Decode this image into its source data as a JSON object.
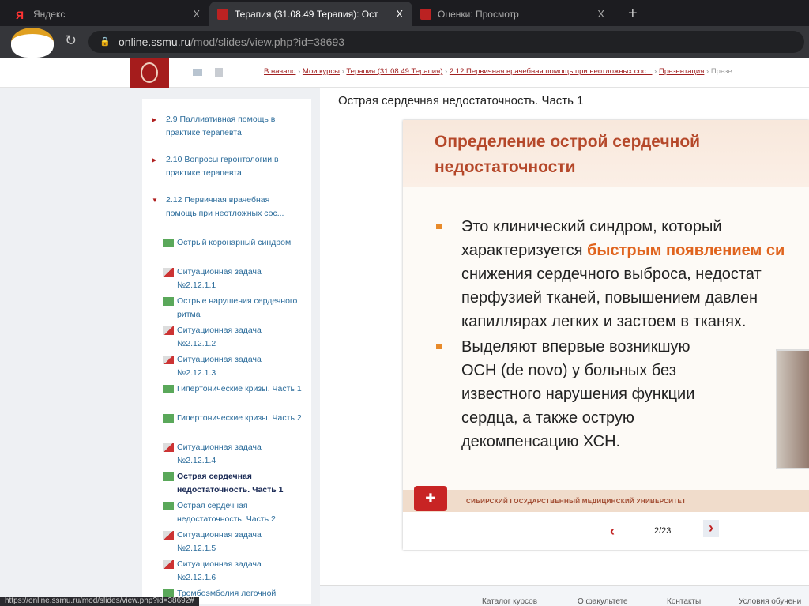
{
  "tabs": [
    {
      "label": "Яндекс",
      "close": "X"
    },
    {
      "label": "Терапия (31.08.49 Терапия): Ост",
      "close": "X"
    },
    {
      "label": "Оценки: Просмотр",
      "close": "X"
    }
  ],
  "new_tab": "+",
  "address": {
    "host": "online.ssmu.ru",
    "path": "/mod/slides/view.php?id=38693"
  },
  "breadcrumbs": [
    "В начало",
    "Мои курсы",
    "Терапия (31.08.49 Терапия)",
    "2.12 Первичная врачебная помощь при неотложных сос...",
    "Презентация",
    "Презе"
  ],
  "sidebar": [
    {
      "label": "2.9 Паллиативная помощь в практике терапевта",
      "type": "section"
    },
    {
      "label": "2.10 Вопросы геронтологии в практике терапевта",
      "type": "section"
    },
    {
      "label": "2.12 Первичная врачебная помощь при неотложных сос...",
      "type": "section-open"
    },
    {
      "label": "Острый коронарный синдром",
      "type": "slides"
    },
    {
      "label": "Ситуационная задача №2.12.1.1",
      "type": "quiz"
    },
    {
      "label": "Острые нарушения сердечного ритма",
      "type": "slides"
    },
    {
      "label": "Ситуационная задача №2.12.1.2",
      "type": "quiz"
    },
    {
      "label": "Ситуационная задача №2.12.1.3",
      "type": "quiz"
    },
    {
      "label": "Гипертонические кризы. Часть 1",
      "type": "slides"
    },
    {
      "label": "Гипертонические кризы. Часть 2",
      "type": "slides"
    },
    {
      "label": "Ситуационная задача №2.12.1.4",
      "type": "quiz"
    },
    {
      "label": "Острая сердечная недостаточность. Часть 1",
      "type": "slides-current"
    },
    {
      "label": "Острая сердечная недостаточность. Часть 2",
      "type": "slides"
    },
    {
      "label": "Ситуационная задача №2.12.1.5",
      "type": "quiz"
    },
    {
      "label": "Ситуационная задача №2.12.1.6",
      "type": "quiz"
    },
    {
      "label": "Тромбоэмболия легочной",
      "type": "slides"
    }
  ],
  "page_title": "Острая сердечная недостаточность. Часть 1",
  "slide": {
    "heading1": "Определение острой сердечной",
    "heading2": "недостаточности",
    "b1_l1": "Это клинический синдром, который",
    "b1_l2a": "характеризуется ",
    "b1_l2b": "быстрым появлением си",
    "b1_l3": "снижения сердечного выброса, недостат",
    "b1_l4": "перфузией тканей, повышением давлен",
    "b1_l5": "капиллярах легких и застоем в тканях.",
    "b2": [
      "Выделяют впервые возникшую",
      "ОСН (de novo) у больных без",
      "известного нарушения функции",
      "сердца, а также острую",
      "декомпенсацию ХСН."
    ],
    "footer": "СИБИРСКИЙ ГОСУДАРСТВЕННЫЙ МЕДИЦИНСКИЙ УНИВЕРСИТЕТ"
  },
  "pager": {
    "prev": "‹",
    "next": "›",
    "counter": "2/23"
  },
  "footer_links": [
    "Каталог курсов",
    "О факультете",
    "Контакты",
    "Условия обучени"
  ],
  "status_url": "https://online.ssmu.ru/mod/slides/view.php?id=38692#"
}
